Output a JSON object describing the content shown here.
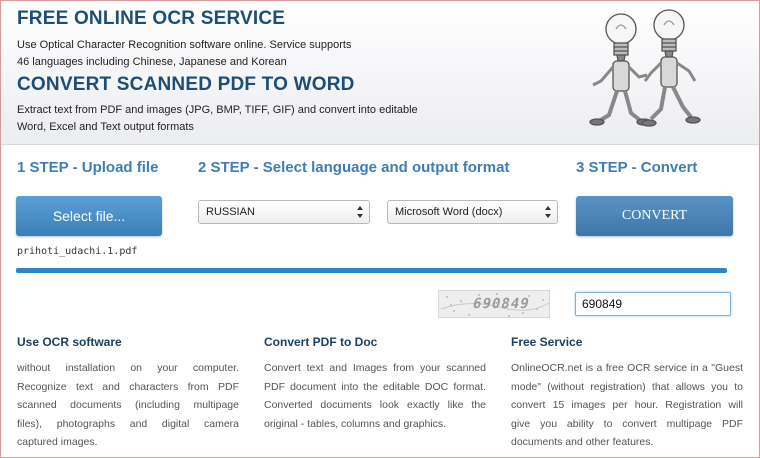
{
  "header": {
    "title1": "FREE ONLINE OCR SERVICE",
    "desc1_line1": "Use Optical Character Recognition software online. Service supports",
    "desc1_line2": "46 languages including Chinese, Japanese and Korean",
    "title2": "CONVERT SCANNED PDF TO WORD",
    "desc2_line1": "Extract text from PDF and images (JPG, BMP, TIFF, GIF) and convert into editable",
    "desc2_line2": "Word, Excel and Text output formats"
  },
  "steps": {
    "step1_title": "1 STEP - Upload file",
    "step2_title": "2 STEP - Select language and output format",
    "step3_title": "3 STEP - Convert"
  },
  "upload": {
    "button_label": "Select file...",
    "filename": "prihoti_udachi.1.pdf",
    "progress": 1.0
  },
  "language_select": {
    "value": "RUSSIAN"
  },
  "format_select": {
    "value": "Microsoft Word (docx)"
  },
  "convert": {
    "button_label": "CONVERT"
  },
  "captcha": {
    "image_text": "690849",
    "input_value": "690849"
  },
  "columns": [
    {
      "title": "Use OCR software",
      "lines": [
        "without installation on your computer.",
        "Recognize text and characters from PDF",
        "scanned documents (including multipage",
        "files), photographs and digital camera",
        "captured images."
      ]
    },
    {
      "title": "Convert PDF to Doc",
      "lines": [
        "Convert text and Images from your scanned",
        "PDF document into the editable DOC format.",
        "Converted documents look exactly like the",
        "original - tables, columns and graphics."
      ]
    },
    {
      "title": "Free Service",
      "lines": [
        "OnlineOCR.net is a free OCR service in a \"Guest",
        "mode\" (without registration) that allows you to",
        "convert 15 images per hour. Registration will",
        "give you ability to convert multipage PDF",
        "documents and other features."
      ]
    }
  ],
  "colors": {
    "title_blue": "#1e4d78",
    "step_blue": "#3f7eb5",
    "button_blue": "#4a8fc8",
    "progress_blue": "#2c85c9"
  },
  "icons": {
    "mascot": "lightbulb-characters-illustration",
    "select_arrows": "updown-arrows-icon"
  }
}
